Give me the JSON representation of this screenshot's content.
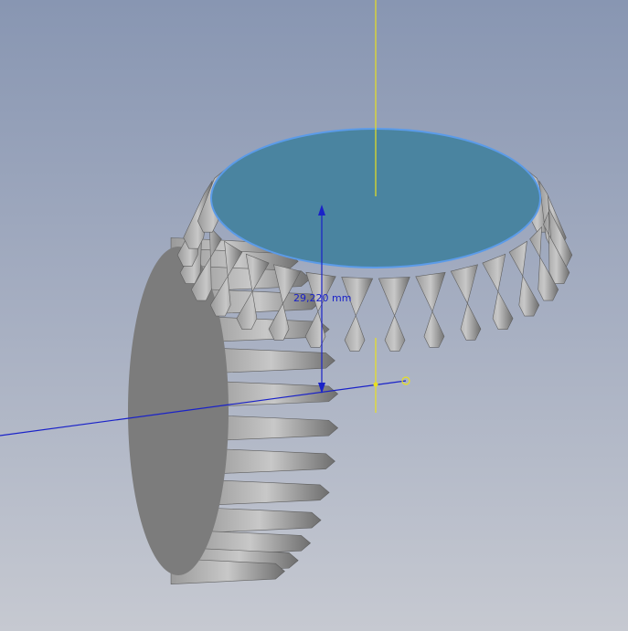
{
  "viewport": {
    "dimension": {
      "value_label": "29,220 mm"
    },
    "colors": {
      "selected_face": "#4a84a0",
      "selected_edge": "#5b9be8",
      "gear_body": "#808080",
      "axis_yellow": "#e8e020",
      "axis_blue": "#1a22c8"
    }
  }
}
